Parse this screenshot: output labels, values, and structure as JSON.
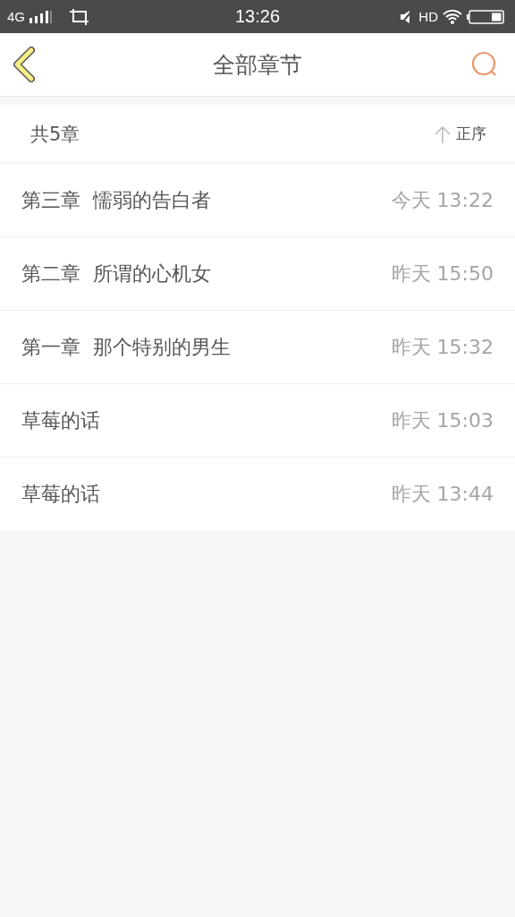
{
  "status_bar": {
    "network": "4G",
    "time": "13:26",
    "hd": "HD"
  },
  "header": {
    "title": "全部章节"
  },
  "summary": {
    "count": "共5章",
    "sort": "正序"
  },
  "chapters": [
    {
      "title": "第三章  懦弱的告白者",
      "time": "今天 13:22"
    },
    {
      "title": "第二章  所谓的心机女",
      "time": "昨天 15:50"
    },
    {
      "title": "第一章  那个特别的男生",
      "time": "昨天 15:32"
    },
    {
      "title": "草莓的话",
      "time": "昨天 15:03"
    },
    {
      "title": "草莓的话",
      "time": "昨天 13:44"
    }
  ]
}
